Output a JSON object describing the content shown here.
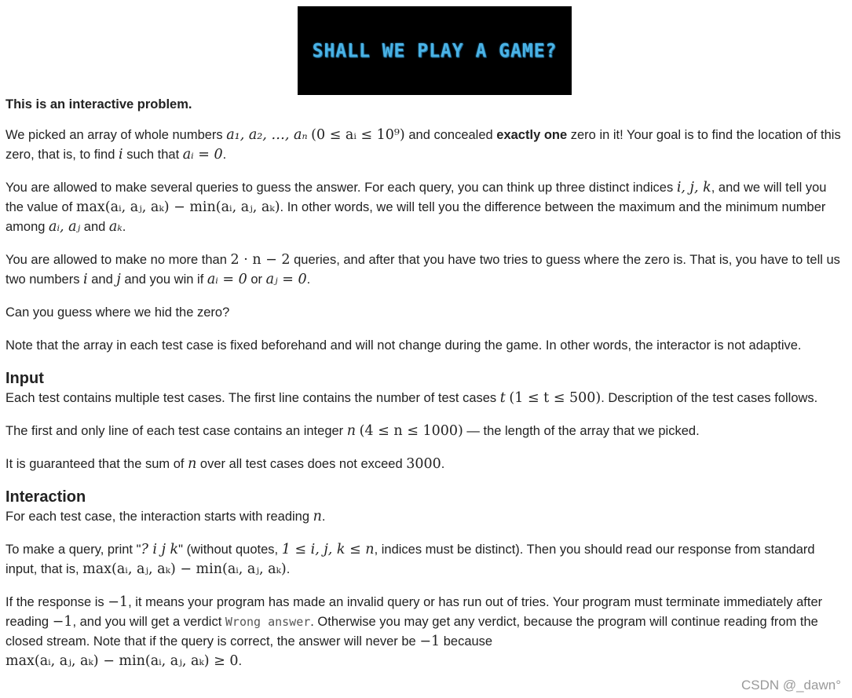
{
  "banner": {
    "text": "SHALL WE PLAY A GAME?"
  },
  "statement": {
    "interactive_note": "This is an interactive problem.",
    "p1_a": "We picked an array of whole numbers ",
    "p1_b": " and concealed ",
    "p1_bold": "exactly one",
    "p1_c": " zero in it! Your goal is to find the location of this zero, that is, to find ",
    "p1_d": " such that ",
    "p2_a": "You are allowed to make several queries to guess the answer. For each query, you can think up three distinct indices ",
    "p2_b": ", and we will tell you the value of ",
    "p2_c": ". In other words, we will tell you the difference between the maximum and the minimum number among ",
    "p2_d": " and ",
    "p3_a": "You are allowed to make no more than ",
    "p3_b": " queries, and after that you have two tries to guess where the zero is. That is, you have to tell us two numbers ",
    "p3_c": " and ",
    "p3_d": " and you win if ",
    "p3_e": " or ",
    "p4": "Can you guess where we hid the zero?",
    "p5": "Note that the array in each test case is fixed beforehand and will not change during the game. In other words, the interactor is not adaptive."
  },
  "input_section": {
    "title": "Input",
    "p1_a": "Each test contains multiple test cases. The first line contains the number of test cases ",
    "p1_b": ". Description of the test cases follows.",
    "p2_a": "The first and only line of each test case contains an integer ",
    "p2_b": " — the length of the array that we picked.",
    "p3_a": "It is guaranteed that the sum of ",
    "p3_b": " over all test cases does not exceed "
  },
  "interaction_section": {
    "title": "Interaction",
    "p1_a": "For each test case, the interaction starts with reading ",
    "p2_a": "To make a query, print \"",
    "p2_query": "? i j k",
    "p2_b": "\" (without quotes, ",
    "p2_c": ", indices must be distinct). Then you should read our response from standard input, that is, ",
    "p3_a": "If the response is ",
    "p3_b": ", it means your program has made an invalid query or has run out of tries. Your program must terminate immediately after reading ",
    "p3_c": ", and you will get a verdict ",
    "p3_verdict": "Wrong answer",
    "p3_d": ". Otherwise you may get any verdict, because the program will continue reading from the closed stream. Note that if the query is correct, the answer will never be ",
    "p3_e": " because"
  },
  "math": {
    "array": "a₁, a₂, …, aₙ",
    "range": "(0 ≤ aᵢ ≤ 10⁹)",
    "i": "i",
    "j": "j",
    "n": "n",
    "ai_zero": "aᵢ = 0",
    "aj_zero": "aⱼ = 0",
    "ijk": "i, j, k",
    "maxmin": "max(aᵢ, aⱼ, aₖ) − min(aᵢ, aⱼ, aₖ)",
    "ai_aj": "aᵢ, aⱼ",
    "ak": "aₖ",
    "two_n": "2 · n − 2",
    "t": "t",
    "t_range": "(1 ≤ t ≤ 500)",
    "n_range": "(4 ≤ n ≤ 1000)",
    "sum_limit": "3000",
    "query_range": "1 ≤ i, j, k ≤ n",
    "minus_one": "−1",
    "final": "max(aᵢ, aⱼ, aₖ) − min(aᵢ, aⱼ, aₖ) ≥ 0"
  },
  "watermark": "CSDN @_dawn°"
}
